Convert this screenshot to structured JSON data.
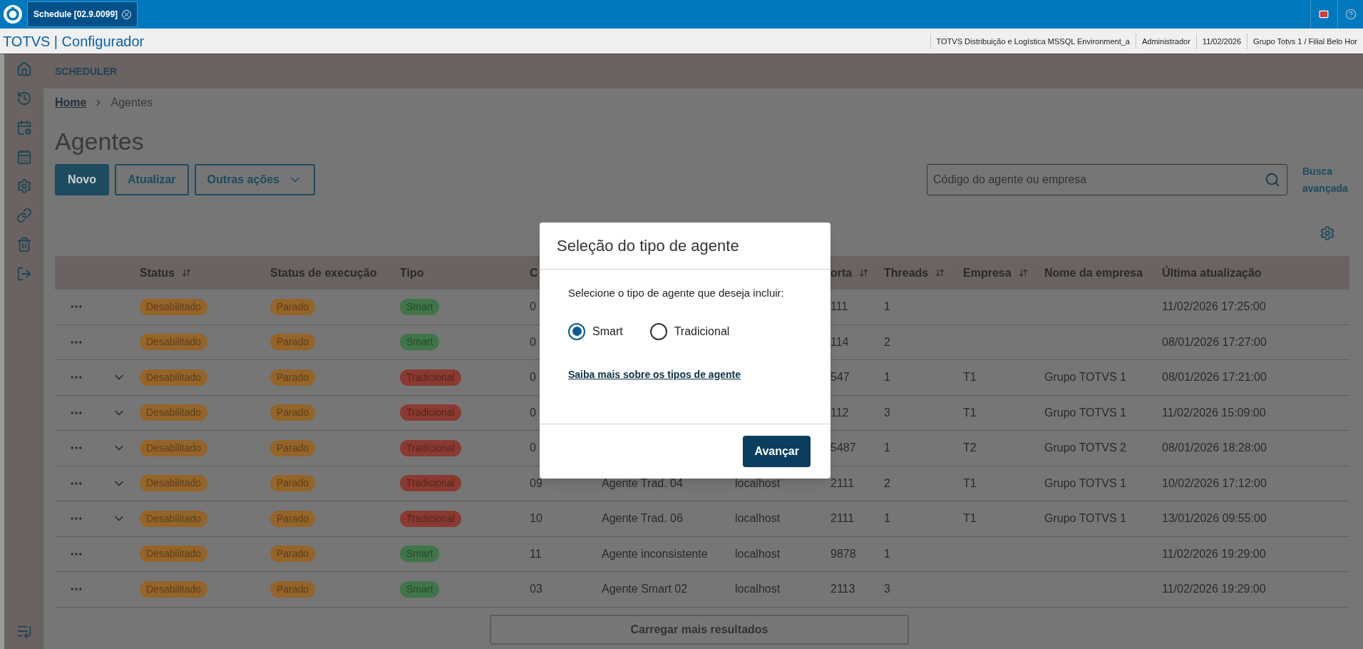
{
  "app_bar": {
    "tab": "Schedule [02.9.0099]"
  },
  "header": {
    "app_title": "TOTVS | Configurador",
    "info": [
      "TOTVS Distribuição e Logística MSSQL Environment_a",
      "Administrador",
      "11/02/2026",
      "Grupo Totvs 1 / Filial Belo Hor"
    ]
  },
  "section_title": "SCHEDULER",
  "breadcrumb": [
    {
      "label": "Home",
      "link": true
    },
    {
      "label": "Agentes",
      "link": false
    }
  ],
  "page_title": "Agentes",
  "actions": [
    {
      "label": "Novo",
      "kind": "primary"
    },
    {
      "label": "Atualizar",
      "kind": "secondary"
    },
    {
      "label": "Outras ações",
      "kind": "dropdown"
    }
  ],
  "search": {
    "placeholder": "Código do agente ou empresa",
    "advanced": "Busca avançada"
  },
  "table": {
    "columns": [
      {
        "kind": "actions"
      },
      {
        "kind": "expand"
      },
      {
        "kind": "text",
        "label": "Status",
        "sortable": true
      },
      {
        "kind": "text",
        "label": "Status de execução",
        "sortable": false
      },
      {
        "kind": "text",
        "label": "Tipo",
        "sortable": false
      },
      {
        "kind": "text",
        "label": "C",
        "sortable": false
      },
      {
        "kind": "covered"
      },
      {
        "kind": "covered"
      },
      {
        "kind": "text",
        "label": "orta",
        "sortable": true
      },
      {
        "kind": "text",
        "label": "Threads",
        "sortable": true
      },
      {
        "kind": "text",
        "label": "Empresa",
        "sortable": true
      },
      {
        "kind": "text",
        "label": "Nome da empresa",
        "sortable": false
      },
      {
        "kind": "text",
        "label": "Última atualização",
        "sortable": false
      }
    ],
    "rows": [
      {
        "expandable": false,
        "status": "Desabilitado",
        "execution": "Parado",
        "type": {
          "label": "Smart",
          "kind": "smart"
        },
        "code": "0",
        "port": "111",
        "threads": "1",
        "updated": "11/02/2026 17:25:00"
      },
      {
        "expandable": false,
        "status": "Desabilitado",
        "execution": "Parado",
        "type": {
          "label": "Smart",
          "kind": "smart"
        },
        "code": "0",
        "port": "114",
        "threads": "2",
        "updated": "08/01/2026 17:27:00"
      },
      {
        "expandable": true,
        "status": "Desabilitado",
        "execution": "Parado",
        "type": {
          "label": "Tradicional",
          "kind": "traditional"
        },
        "code": "0",
        "port": "547",
        "threads": "1",
        "company": "T1",
        "company_name": "Grupo TOTVS 1",
        "updated": "08/01/2026 17:21:00"
      },
      {
        "expandable": true,
        "status": "Desabilitado",
        "execution": "Parado",
        "type": {
          "label": "Tradicional",
          "kind": "traditional"
        },
        "code": "0",
        "port": "112",
        "threads": "3",
        "company": "T1",
        "company_name": "Grupo TOTVS 1",
        "updated": "11/02/2026 15:09:00"
      },
      {
        "expandable": true,
        "status": "Desabilitado",
        "execution": "Parado",
        "type": {
          "label": "Tradicional",
          "kind": "traditional"
        },
        "code": "0",
        "port": "5487",
        "threads": "1",
        "company": "T2",
        "company_name": "Grupo TOTVS 2",
        "updated": "08/01/2026 18:28:00"
      },
      {
        "expandable": true,
        "status": "Desabilitado",
        "execution": "Parado",
        "type": {
          "label": "Tradicional",
          "kind": "traditional"
        },
        "code": "09",
        "name": "Agente Trad. 04",
        "host": "localhost",
        "port": "2111",
        "threads": "2",
        "company": "T1",
        "company_name": "Grupo TOTVS 1",
        "updated": "10/02/2026 17:12:00"
      },
      {
        "expandable": true,
        "status": "Desabilitado",
        "execution": "Parado",
        "type": {
          "label": "Tradicional",
          "kind": "traditional"
        },
        "code": "10",
        "name": "Agente Trad. 06",
        "host": "localhost",
        "port": "2111",
        "threads": "1",
        "company": "T1",
        "company_name": "Grupo TOTVS 1",
        "updated": "13/01/2026 09:55:00"
      },
      {
        "expandable": false,
        "status": "Desabilitado",
        "execution": "Parado",
        "type": {
          "label": "Smart",
          "kind": "smart"
        },
        "code": "11",
        "name": "Agente inconsistente",
        "host": "localhost",
        "port": "9878",
        "threads": "1",
        "updated": "11/02/2026 19:29:00"
      },
      {
        "expandable": false,
        "status": "Desabilitado",
        "execution": "Parado",
        "type": {
          "label": "Smart",
          "kind": "smart"
        },
        "code": "03",
        "name": "Agente Smart 02",
        "host": "localhost",
        "port": "2113",
        "threads": "3",
        "updated": "11/02/2026 19:29:00"
      }
    ],
    "load_more": "Carregar mais resultados"
  },
  "dialog": {
    "title": "Seleção do tipo de agente",
    "prompt": "Selecione o tipo de agente que deseja incluir:",
    "options": [
      {
        "label": "Smart",
        "selected": true
      },
      {
        "label": "Tradicional",
        "selected": false
      }
    ],
    "link": "Saiba mais sobre os tipos de agente",
    "button": "Avançar"
  }
}
